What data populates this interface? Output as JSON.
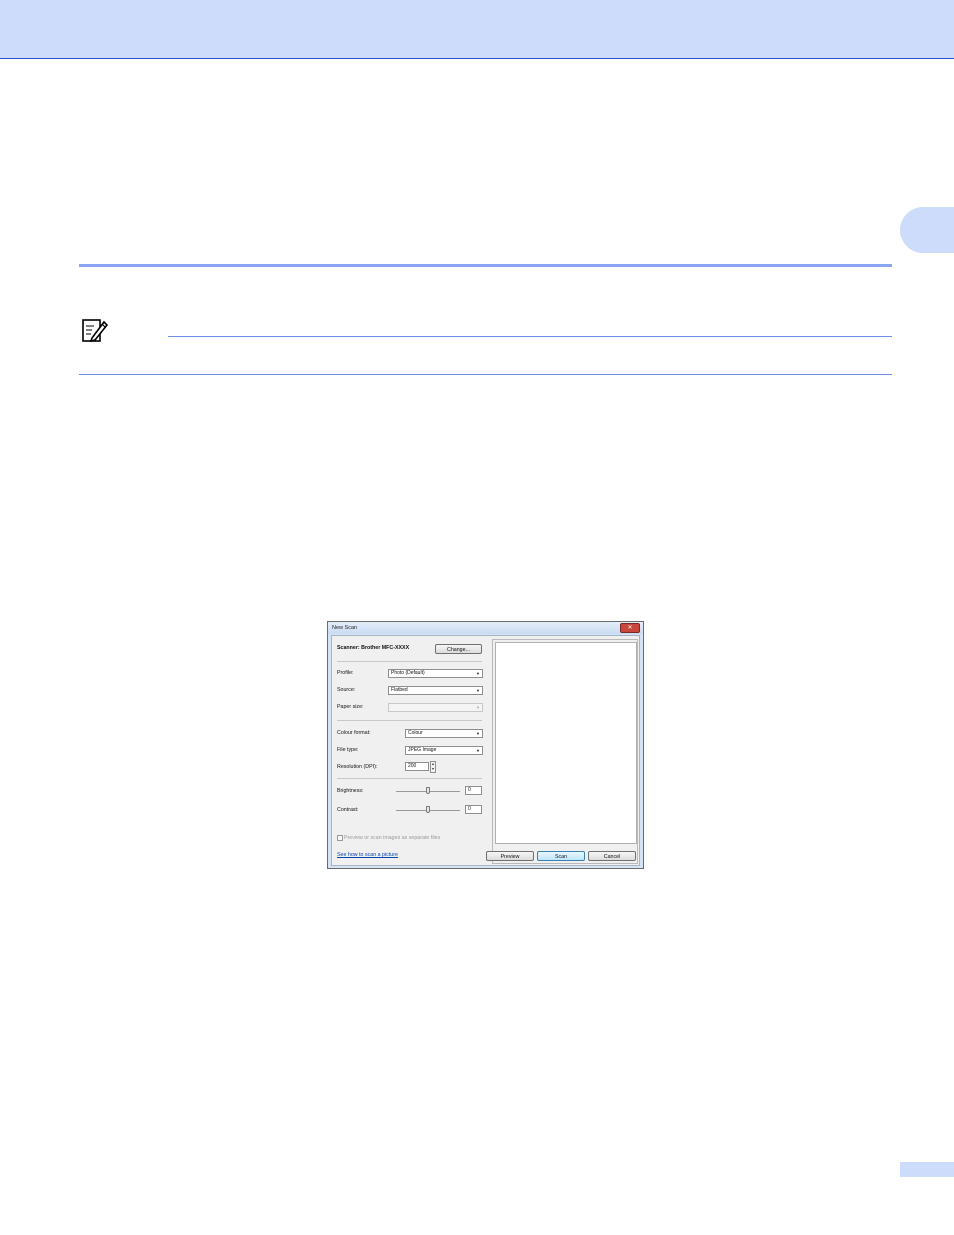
{
  "dialog": {
    "title": "New Scan",
    "close_symbol": "✕",
    "scanner_label": "Scanner: Brother MFC-XXXX",
    "change_button": "Change...",
    "profile": {
      "label": "Profile:",
      "value": "Photo (Default)"
    },
    "source": {
      "label": "Source:",
      "value": "Flatbed"
    },
    "paper_size": {
      "label": "Paper size:",
      "value": ""
    },
    "colour_format": {
      "label": "Colour format:",
      "value": "Colour"
    },
    "file_type": {
      "label": "File type:",
      "value": "JPEG Image"
    },
    "resolution": {
      "label": "Resolution (DPI):",
      "value": "200"
    },
    "brightness": {
      "label": "Brightness:",
      "value": "0",
      "level": 0.5
    },
    "contrast": {
      "label": "Contrast:",
      "value": "0",
      "level": 0.5
    },
    "separate_files_checkbox": {
      "label": "Preview or scan images as separate files",
      "checked": false
    },
    "help_link": "See how to scan a picture",
    "buttons": {
      "preview": "Preview",
      "scan": "Scan",
      "cancel": "Cancel"
    },
    "icons": {
      "close": "close-icon",
      "dropdown": "chevron-down-icon",
      "note": "note-pencil-icon"
    }
  }
}
